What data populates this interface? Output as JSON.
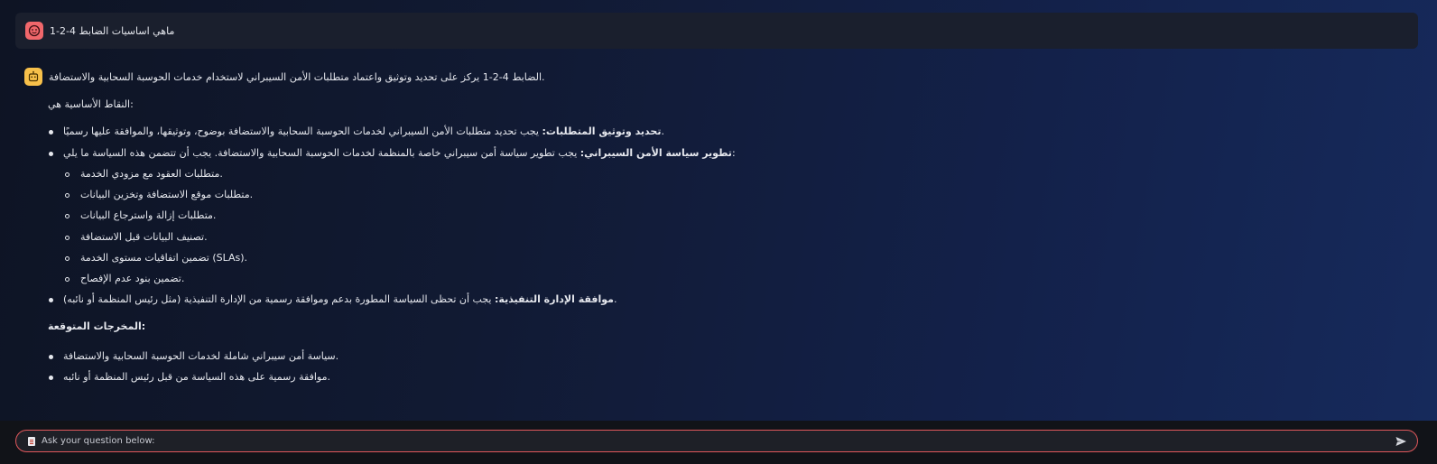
{
  "conversation": {
    "user_message": "ماهي اساسيات الضابط 4-2-1",
    "user_avatar_icon": "user-face-icon",
    "bot_avatar_icon": "bot-face-icon",
    "bot": {
      "intro": "الضابط 4-2-1 يركز على تحديد وتوثيق واعتماد متطلبات الأمن السيبراني لاستخدام خدمات الحوسبة السحابية والاستضافة.",
      "key_points_heading": "النقاط الأساسية هي:",
      "bullets": [
        {
          "bold": "تحديد وتوثيق المتطلبات:",
          "text": " يجب تحديد متطلبات الأمن السيبراني لخدمات الحوسبة السحابية والاستضافة بوضوح، وتوثيقها، والموافقة عليها رسميًا."
        },
        {
          "bold": "تطوير سياسة الأمن السيبراني:",
          "text": " يجب تطوير سياسة أمن سيبراني خاصة بالمنظمة لخدمات الحوسبة السحابية والاستضافة. يجب أن تتضمن هذه السياسة ما يلي:"
        },
        {
          "bold": "موافقة الإدارة التنفيذية:",
          "text": " يجب أن تحظى السياسة المطورة بدعم وموافقة رسمية من الإدارة التنفيذية (مثل رئيس المنظمة أو نائبه)."
        }
      ],
      "sub_items": [
        "متطلبات العقود مع مزودي الخدمة.",
        "متطلبات موقع الاستضافة وتخزين البيانات.",
        "متطلبات إزالة واسترجاع البيانات.",
        "تصنيف البيانات قبل الاستضافة.",
        "تضمين اتفاقيات مستوى الخدمة (SLAs).",
        "تضمين بنود عدم الإفصاح."
      ],
      "outputs_heading": "المخرجات المتوقعة:",
      "outputs": [
        "سياسة أمن سيبراني شاملة لخدمات الحوسبة السحابية والاستضافة.",
        "موافقة رسمية على هذه السياسة من قبل رئيس المنظمة أو نائبه."
      ]
    }
  },
  "input": {
    "placeholder": "Ask your question below:",
    "doc_icon": "document-icon",
    "send_icon": "send-icon"
  },
  "colors": {
    "user_avatar": "#f0676b",
    "bot_avatar": "#f7c04a",
    "input_border": "#e0575b"
  }
}
